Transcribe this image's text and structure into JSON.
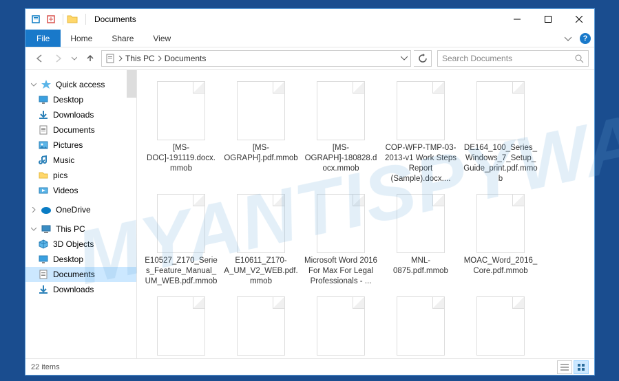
{
  "window": {
    "title": "Documents"
  },
  "ribbon": {
    "file": "File",
    "tabs": [
      "Home",
      "Share",
      "View"
    ]
  },
  "breadcrumb": {
    "root": "This PC",
    "current": "Documents"
  },
  "search": {
    "placeholder": "Search Documents"
  },
  "sidebar": {
    "quick_access": "Quick access",
    "quick_items": [
      {
        "label": "Desktop",
        "icon": "desktop"
      },
      {
        "label": "Downloads",
        "icon": "downloads"
      },
      {
        "label": "Documents",
        "icon": "documents"
      },
      {
        "label": "Pictures",
        "icon": "pictures"
      },
      {
        "label": "Music",
        "icon": "music"
      },
      {
        "label": "pics",
        "icon": "folder"
      },
      {
        "label": "Videos",
        "icon": "videos"
      }
    ],
    "onedrive": "OneDrive",
    "this_pc": "This PC",
    "pc_items": [
      {
        "label": "3D Objects",
        "icon": "3d"
      },
      {
        "label": "Desktop",
        "icon": "desktop"
      },
      {
        "label": "Documents",
        "icon": "documents",
        "selected": true
      },
      {
        "label": "Downloads",
        "icon": "downloads"
      }
    ]
  },
  "files": [
    {
      "name": "[MS-DOC]-191119.docx.mmob"
    },
    {
      "name": "[MS-OGRAPH].pdf.mmob"
    },
    {
      "name": "[MS-OGRAPH]-180828.docx.mmob"
    },
    {
      "name": "COP-WFP-TMP-03-2013-v1 Work Steps Report (Sample).docx...."
    },
    {
      "name": "DE164_100_Series_Windows_7_Setup_Guide_print.pdf.mmob"
    },
    {
      "name": "E10527_Z170_Series_Feature_Manual_UM_WEB.pdf.mmob"
    },
    {
      "name": "E10611_Z170-A_UM_V2_WEB.pdf.mmob"
    },
    {
      "name": "Microsoft Word 2016 For Max For Legal Professionals - ..."
    },
    {
      "name": "MNL-0875.pdf.mmob"
    },
    {
      "name": "MOAC_Word_2016_Core.pdf.mmob"
    },
    {
      "name": ""
    },
    {
      "name": ""
    },
    {
      "name": ""
    },
    {
      "name": ""
    },
    {
      "name": ""
    }
  ],
  "status": {
    "count": "22 items"
  },
  "watermark": "MYANTISPYWARE.COM"
}
